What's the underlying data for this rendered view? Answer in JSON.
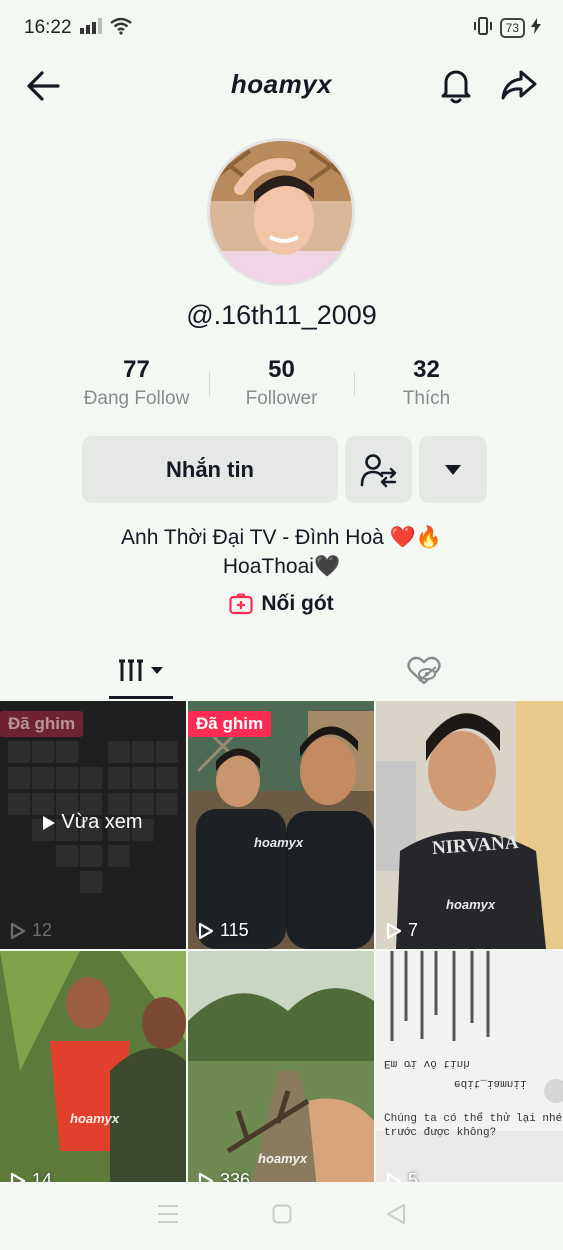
{
  "status": {
    "time": "16:22",
    "battery": "73"
  },
  "header": {
    "title": "hoamyx"
  },
  "profile": {
    "handle": "@.16th11_2009",
    "stats": [
      {
        "value": "77",
        "label": "Đang Follow"
      },
      {
        "value": "50",
        "label": "Follower"
      },
      {
        "value": "32",
        "label": "Thích"
      }
    ],
    "message_label": "Nhắn tin",
    "bio_line1": "Anh Thời Đại TV - Đình Hoà ❤️🔥",
    "bio_line2": "HoaThoai🖤",
    "link_label": "Nối gót"
  },
  "videos": [
    {
      "pinned_label": "Đã ghim",
      "views": "12",
      "overlay": "Vừa xem"
    },
    {
      "pinned_label": "Đã ghim",
      "views": "115",
      "watermark": "hoamyx"
    },
    {
      "views": "7",
      "watermark": "hoamyx",
      "shirt_text": "NIRVANA"
    },
    {
      "views": "14",
      "watermark": "hoamyx"
    },
    {
      "views": "336",
      "watermark": "hoamyx"
    },
    {
      "views": "5",
      "text_lines": [
        "Em ơi vô tình",
        "edit_iamnii",
        "Chúng ta có thể thử lại nhé",
        "trước được không?"
      ]
    }
  ],
  "colors": {
    "accent": "#fe2c55",
    "background": "#f4f8f3",
    "button_bg": "#e6e8e6"
  }
}
